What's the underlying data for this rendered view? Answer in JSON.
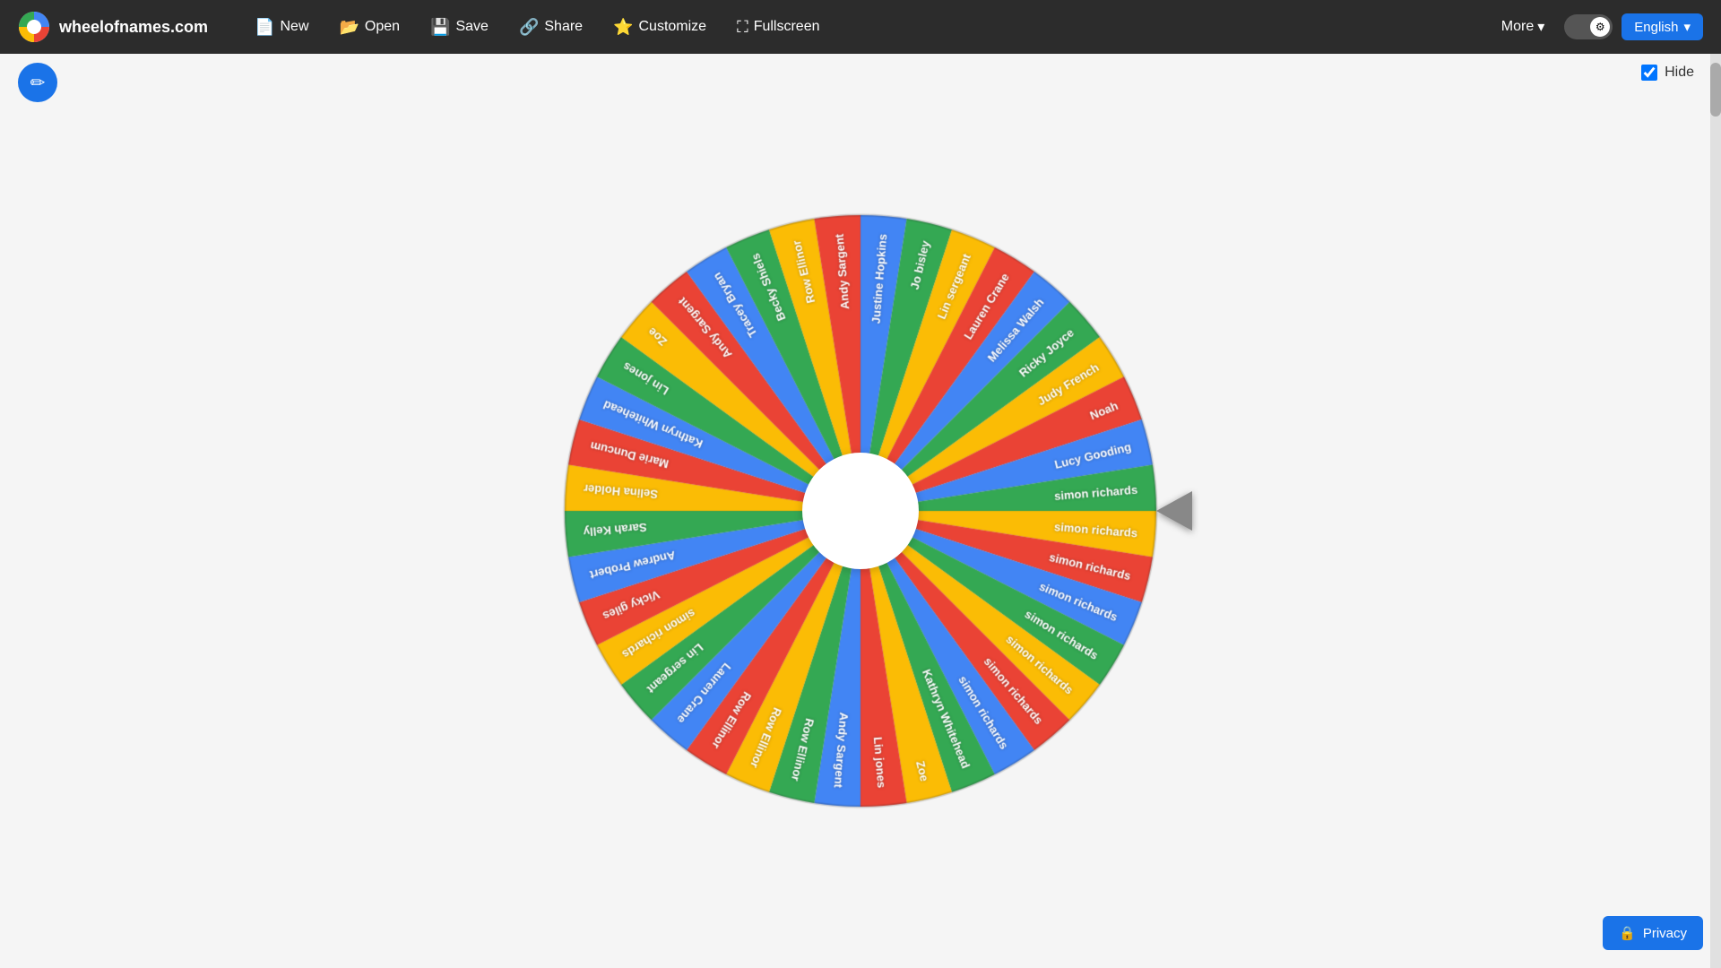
{
  "site": {
    "title": "wheelofnames.com",
    "logo_colors": [
      "#4285F4",
      "#EA4335",
      "#FBBC05",
      "#34A853"
    ]
  },
  "navbar": {
    "new_label": "New",
    "open_label": "Open",
    "save_label": "Save",
    "share_label": "Share",
    "customize_label": "Customize",
    "fullscreen_label": "Fullscreen",
    "more_label": "More",
    "language_label": "English"
  },
  "hide_label": "Hide",
  "privacy_label": "Privacy",
  "wheel": {
    "segments": [
      {
        "label": "Justine Hopkins",
        "color": "#4285F4"
      },
      {
        "label": "Jo bisley",
        "color": "#34A853"
      },
      {
        "label": "Lin sergeant",
        "color": "#FBBC05"
      },
      {
        "label": "Lauren Crane",
        "color": "#EA4335"
      },
      {
        "label": "Melissa Walsh",
        "color": "#4285F4"
      },
      {
        "label": "Ricky Joyce",
        "color": "#34A853"
      },
      {
        "label": "Judy French",
        "color": "#FBBC05"
      },
      {
        "label": "Noah",
        "color": "#EA4335"
      },
      {
        "label": "Lucy Gooding",
        "color": "#4285F4"
      },
      {
        "label": "simon richards",
        "color": "#34A853"
      },
      {
        "label": "simon richards",
        "color": "#FBBC05"
      },
      {
        "label": "simon richards",
        "color": "#EA4335"
      },
      {
        "label": "simon richards",
        "color": "#4285F4"
      },
      {
        "label": "simon richards",
        "color": "#34A853"
      },
      {
        "label": "simon richards",
        "color": "#FBBC05"
      },
      {
        "label": "simon richards",
        "color": "#EA4335"
      },
      {
        "label": "simon richards",
        "color": "#4285F4"
      },
      {
        "label": "Kathryn Whitehead",
        "color": "#34A853"
      },
      {
        "label": "Zoe",
        "color": "#FBBC05"
      },
      {
        "label": "Lin jones",
        "color": "#EA4335"
      },
      {
        "label": "Andy Sargent",
        "color": "#4285F4"
      },
      {
        "label": "Row Ellinor",
        "color": "#34A853"
      },
      {
        "label": "Row Ellinor",
        "color": "#FBBC05"
      },
      {
        "label": "Row Ellinor",
        "color": "#EA4335"
      },
      {
        "label": "Lauren Crane",
        "color": "#4285F4"
      },
      {
        "label": "Lin sergeant",
        "color": "#34A853"
      },
      {
        "label": "simon richards",
        "color": "#FBBC05"
      },
      {
        "label": "Vicky giles",
        "color": "#EA4335"
      },
      {
        "label": "Andrew Probert",
        "color": "#4285F4"
      },
      {
        "label": "Sarah Kelly",
        "color": "#34A853"
      },
      {
        "label": "Selina Holder",
        "color": "#FBBC05"
      },
      {
        "label": "Marie Duncum",
        "color": "#EA4335"
      },
      {
        "label": "Kathryn Whitehead",
        "color": "#4285F4"
      },
      {
        "label": "Lin jones",
        "color": "#34A853"
      },
      {
        "label": "Zoe",
        "color": "#FBBC05"
      },
      {
        "label": "Andy Sargent",
        "color": "#EA4335"
      },
      {
        "label": "Tracey Bryan",
        "color": "#4285F4"
      },
      {
        "label": "Becky Shiels",
        "color": "#34A853"
      },
      {
        "label": "Row Ellinor",
        "color": "#FBBC05"
      },
      {
        "label": "Andy Sargent",
        "color": "#EA4335"
      }
    ]
  }
}
